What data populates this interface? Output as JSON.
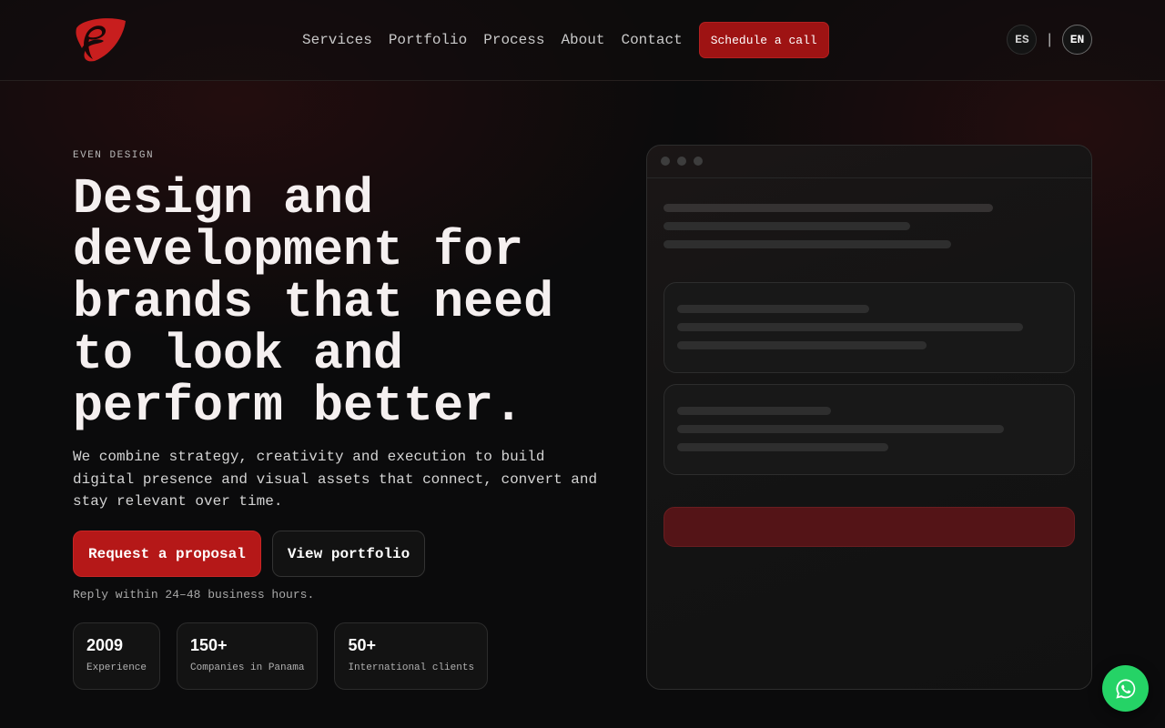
{
  "nav": {
    "items": [
      {
        "label": "Services"
      },
      {
        "label": "Portfolio"
      },
      {
        "label": "Process"
      },
      {
        "label": "About"
      },
      {
        "label": "Contact"
      }
    ],
    "cta_label": "Schedule a call"
  },
  "lang": {
    "options": [
      "ES",
      "EN"
    ],
    "active": "EN",
    "separator": "|"
  },
  "hero": {
    "eyebrow": "EVEN DESIGN",
    "headline": "Design and development for brands that need to look and perform better.",
    "sub": "We combine strategy, creativity and execution to build digital presence and visual assets that connect, convert and stay relevant over time.",
    "primary_button": "Request a proposal",
    "secondary_button": "View portfolio",
    "reply_note": "Reply within 24–48 business hours."
  },
  "stats": [
    {
      "value": "2009",
      "label": "Experience"
    },
    {
      "value": "150+",
      "label": "Companies in Panama"
    },
    {
      "value": "50+",
      "label": "International clients"
    }
  ],
  "colors": {
    "accent": "#b51818",
    "whatsapp": "#25d366",
    "background": "#0b0b0c"
  },
  "icons": {
    "logo": "brand-logo-icon",
    "whatsapp": "whatsapp-icon"
  }
}
